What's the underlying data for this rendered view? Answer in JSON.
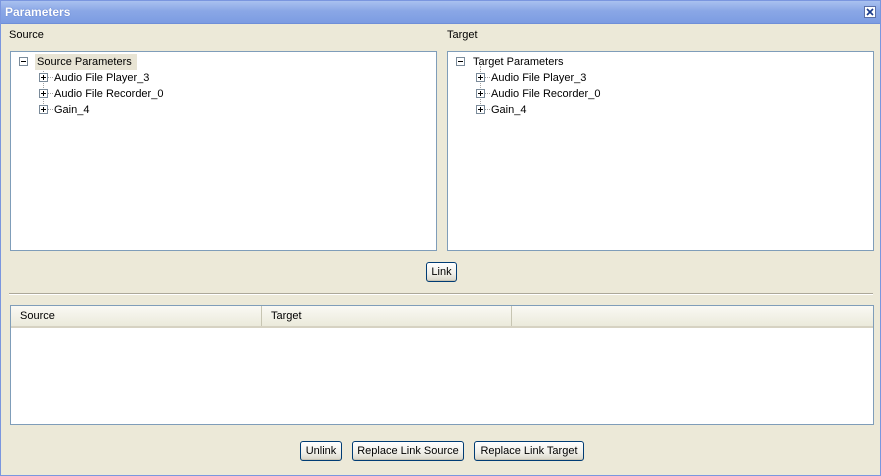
{
  "window": {
    "title": "Parameters"
  },
  "source_panel": {
    "label": "Source",
    "tree": {
      "root": "Source Parameters",
      "children": [
        "Audio File Player_3",
        "Audio File Recorder_0",
        "Gain_4"
      ]
    }
  },
  "target_panel": {
    "label": "Target",
    "tree": {
      "root": "Target Parameters",
      "children": [
        "Audio File Player_3",
        "Audio File Recorder_0",
        "Gain_4"
      ]
    }
  },
  "link_button": "Link",
  "links_table": {
    "columns": [
      "Source",
      "Target",
      ""
    ],
    "rows": []
  },
  "footer_buttons": {
    "unlink": "Unlink",
    "replace_source": "Replace Link Source",
    "replace_target": "Replace Link Target"
  },
  "colors": {
    "title_bar": "#8aa7e6",
    "dialog_background": "#ece9d8",
    "panel_border": "#7f9db9",
    "button_border": "#003c74"
  }
}
